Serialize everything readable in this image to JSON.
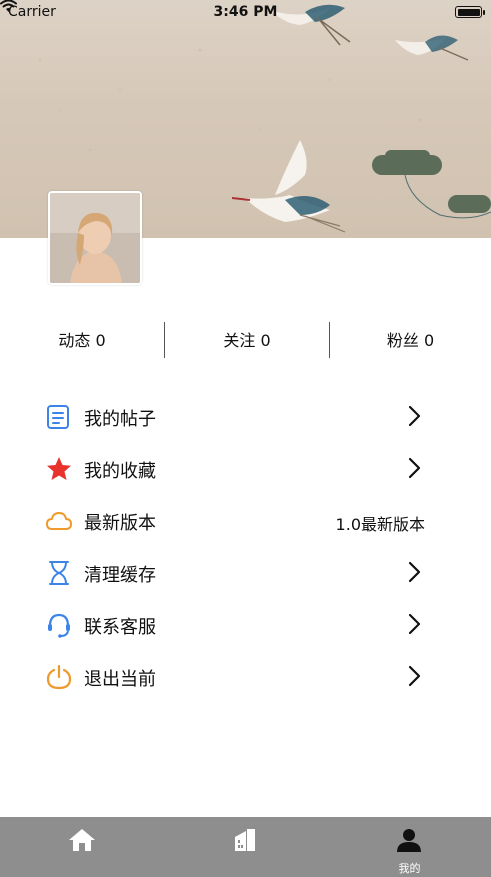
{
  "status_bar": {
    "carrier": "Carrier",
    "time": "3:46 PM"
  },
  "profile": {
    "avatar": "avatar"
  },
  "stats": [
    {
      "label": "动态 0"
    },
    {
      "label": "关注 0"
    },
    {
      "label": "粉丝 0"
    }
  ],
  "menu": [
    {
      "label": "我的帖子",
      "icon": "document-list-icon",
      "color": "#3d84e8"
    },
    {
      "label": "我的收藏",
      "icon": "star-icon",
      "color": "#e8322c"
    },
    {
      "label": "最新版本",
      "icon": "cloud-icon",
      "color": "#ef9a2d",
      "value": "1.0最新版本"
    },
    {
      "label": "清理缓存",
      "icon": "hourglass-icon",
      "color": "#3d84e8"
    },
    {
      "label": "联系客服",
      "icon": "headset-icon",
      "color": "#3d84e8"
    },
    {
      "label": "退出当前",
      "icon": "power-icon",
      "color": "#ef9a2d"
    }
  ],
  "tabbar": {
    "tabs": [
      {
        "icon": "home-icon",
        "label": ""
      },
      {
        "icon": "building-icon",
        "label": ""
      },
      {
        "icon": "person-icon",
        "label": "我的"
      }
    ],
    "background": "#8e8e8e"
  }
}
